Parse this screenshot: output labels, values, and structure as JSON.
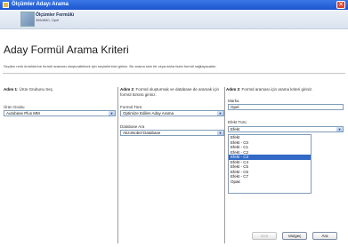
{
  "window": {
    "title": "Ölçümler Adayı Arama",
    "close_symbol": "✕"
  },
  "header": {
    "title": "Ölçümler Formülü",
    "subtitle": "3564650, Opel"
  },
  "page": {
    "title": "Aday Formül Arama Kriteri",
    "description": "Seçilen renk örneklerine formül araması oluşturabilmek için seçimlerinizi giriniz. Bu arama size bir veya daha fazla formül sağlayacaktır."
  },
  "step1": {
    "heading": "Adım 1",
    "text": ": Ürün Grubunu Seç.",
    "product_group_label": "Ürün Grubu",
    "product_group_value": "Autobase Plus MM"
  },
  "step2": {
    "heading": "Adım 2",
    "text": ": Formül oluşturmak ve database de aramak için formül türünü giriniz.",
    "formula_type_label": "Formül Türü",
    "formula_type_value": "Optimize Edilen Aday Arama",
    "database_label": "Database Ara",
    "database_value": "AkzoNobel Database"
  },
  "step3": {
    "heading": "Adım 3",
    "text": ": Formül araması için arama kriteri giriniz.",
    "brand_label": "Marka",
    "brand_value": "Opel",
    "effect_label": "Efekt Türü",
    "effect_value": "Efekt",
    "effect_options": [
      "Efekt",
      "Efekt - C0",
      "Efekt - C1",
      "Efekt - C2",
      "Efekt - C3",
      "Efekt - C4",
      "Efekt - C5",
      "Efekt - C6",
      "Efekt - C7",
      "Opak"
    ],
    "effect_selected_index": 4
  },
  "buttons": {
    "back": "Geri",
    "cancel": "Vazgeç",
    "search": "Ara"
  },
  "icons": {
    "dropdown": "▼"
  }
}
